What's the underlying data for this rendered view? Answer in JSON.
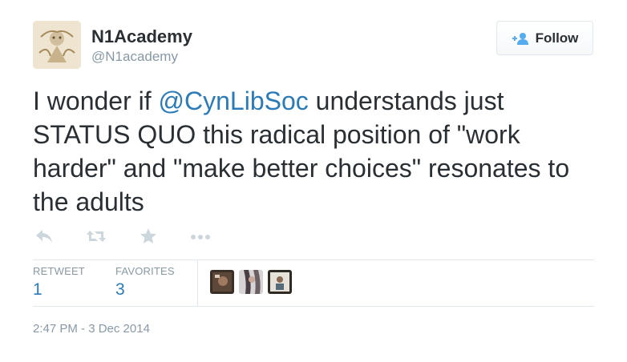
{
  "user": {
    "display_name": "N1Academy",
    "screen_name": "@N1academy",
    "avatar_icon": "n1academy-logo-icon"
  },
  "follow_button": {
    "label": "Follow",
    "icon": "add-user-icon",
    "color": "#55acee"
  },
  "tweet": {
    "text_before": "I wonder if ",
    "mention": "@CynLibSoc",
    "text_after": " understands just STATUS QUO this radical position of \"work harder\" and \"make better choices\" resonates to the adults"
  },
  "actions": [
    {
      "icon": "reply-icon"
    },
    {
      "icon": "retweet-icon"
    },
    {
      "icon": "star-icon"
    },
    {
      "icon": "more-icon"
    }
  ],
  "stats": {
    "retweets_label": "RETWEET",
    "retweets_value": "1",
    "favorites_label": "FAVORITES",
    "favorites_value": "3"
  },
  "favorited_by": [
    {
      "icon": "user-avatar-1"
    },
    {
      "icon": "user-avatar-2"
    },
    {
      "icon": "user-avatar-3"
    }
  ],
  "timestamp": "2:47 PM - 3 Dec 2014",
  "colors": {
    "link": "#2b7bb9",
    "muted": "#8899a6",
    "text": "#292f33",
    "icon": "#ccd6dd"
  }
}
